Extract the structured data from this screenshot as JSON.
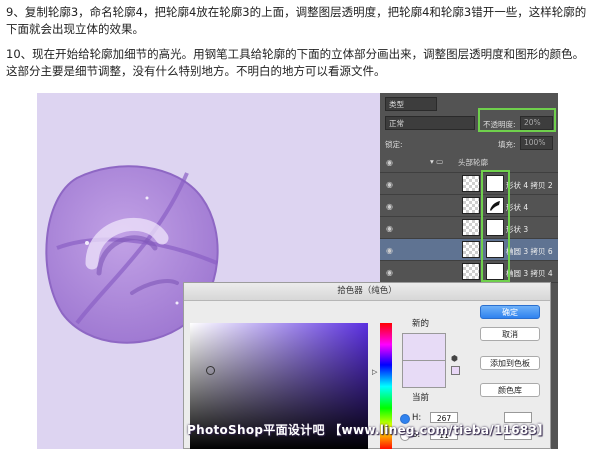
{
  "paragraphs": {
    "step9": "9、复制轮廓3，命名轮廓4，把轮廓4放在轮廓3的上面，调整图层透明度，把轮廓4和轮廓3错开一些，这样轮廓的下面就会出现立体的效果。",
    "step10": "10、现在开始给轮廓加细节的高光。用钢笔工具给轮廓的下面的立体部分画出来，调整图层透明度和图形的颜色。这部分主要是细节调整，没有什么特别地方。不明白的地方可以看源文件。"
  },
  "layers_panel": {
    "filter_kind": "类型",
    "blend_mode": "正常",
    "opacity_label": "不透明度:",
    "opacity_value": "20%",
    "lock_label": "锁定:",
    "fill_label": "填充:",
    "fill_value": "100%",
    "group_name": "头部轮廓",
    "layers": [
      {
        "name": "形状 4 拷贝 2",
        "selected": false,
        "shape": "blank"
      },
      {
        "name": "形状 4",
        "selected": false,
        "shape": "stroke"
      },
      {
        "name": "形状 3",
        "selected": false,
        "shape": "blank"
      },
      {
        "name": "椭圆 3 拷贝 6",
        "selected": true,
        "shape": "dots"
      },
      {
        "name": "椭圆 3 拷贝 4",
        "selected": false,
        "shape": "dots"
      }
    ]
  },
  "color_picker": {
    "title": "拾色器（纯色）",
    "new_label": "新的",
    "current_label": "当前",
    "ok": "确定",
    "cancel": "取消",
    "add_swatch": "添加到色板",
    "color_libraries": "颜色库",
    "h_label": "H:",
    "h_value": "267",
    "s_label": "S:",
    "s_value": "11",
    "new_color": "#e7dbf6",
    "current_color": "#e7dbf6"
  },
  "watermark": "PhotoShop平面设计吧 【www.lineg.com/tieba/11683】",
  "colors": {
    "highlight": "#6fd04c",
    "canvas_bg": "#ddd4f1",
    "shape_purple": "#a983d3"
  }
}
